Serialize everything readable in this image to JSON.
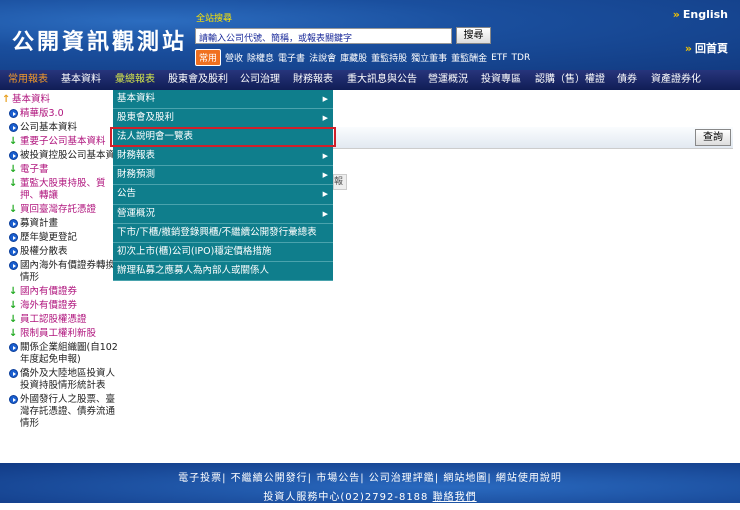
{
  "header": {
    "logo": "公開資訊觀測站",
    "search_label": "全站搜尋",
    "search_placeholder": "請輸入公司代號、簡稱，或報表關鍵字",
    "search_button": "搜尋",
    "quick_tag": "常用",
    "quick_links": [
      "營收",
      "除權息",
      "電子書",
      "法說會",
      "庫藏股",
      "董監持股",
      "獨立董事",
      "董監酬金",
      "ETF",
      "TDR"
    ],
    "english": "English",
    "home": "回首頁"
  },
  "nav": [
    "常用報表",
    "基本資料",
    "彙總報表",
    "股東會及股利",
    "公司治理",
    "財務報表",
    "重大訊息與公告",
    "營運概況",
    "投資專區",
    "認購（售）權證",
    "債券",
    "資產證券化"
  ],
  "sidebar": [
    {
      "t": "基本資料",
      "k": "top"
    },
    {
      "t": "精華版3.0",
      "k": "sub-ic"
    },
    {
      "t": "公司基本資料",
      "k": "ic"
    },
    {
      "t": "重要子公司基本資料",
      "k": "dl"
    },
    {
      "t": "被投資控股公司基本資",
      "k": "ic"
    },
    {
      "t": "電子書",
      "k": "dl"
    },
    {
      "t": "董監大股東持股、質押、轉讓",
      "k": "dl"
    },
    {
      "t": "買回臺灣存託憑證",
      "k": "dl"
    },
    {
      "t": "募資計畫",
      "k": "ic"
    },
    {
      "t": "歷年變更登記",
      "k": "ic"
    },
    {
      "t": "股權分散表",
      "k": "ic"
    },
    {
      "t": "國內海外有價證券轉換情形",
      "k": "ic"
    },
    {
      "t": "國內有價證券",
      "k": "dl"
    },
    {
      "t": "海外有價證券",
      "k": "dl"
    },
    {
      "t": "員工認股權憑證",
      "k": "dl"
    },
    {
      "t": "限制員工權利新股",
      "k": "dl"
    },
    {
      "t": "關係企業組織圖(自102年度起免申報)",
      "k": "ic"
    },
    {
      "t": "僑外及大陸地區投資人投資持股情形統計表",
      "k": "ic"
    },
    {
      "t": "外國發行人之股票、臺灣存託憑證、債券流通情形",
      "k": "ic"
    }
  ],
  "menu": [
    {
      "t": "基本資料",
      "sub": true
    },
    {
      "t": "股東會及股利",
      "sub": true
    },
    {
      "t": "法人說明會一覽表",
      "sub": false
    },
    {
      "t": "財務報表",
      "sub": true
    },
    {
      "t": "財務預測",
      "sub": true
    },
    {
      "t": "公告",
      "sub": true
    },
    {
      "t": "營運概況",
      "sub": true
    },
    {
      "t": "下市/下櫃/撤銷登錄興櫃/不繼續公開發行彙總表",
      "sub": false
    },
    {
      "t": "初次上市(櫃)公司(IPO)穩定價格措施",
      "sub": false
    },
    {
      "t": "辦理私募之應募人為內部人或關係人",
      "sub": false
    }
  ],
  "query_button": "查詢",
  "fragment": "報",
  "footer": {
    "links": [
      "電子投票",
      "不繼續公開發行",
      "市場公告",
      "公司治理評鑑",
      "網站地圖",
      "網站使用說明"
    ],
    "service": "投資人服務中心(02)2792-8188",
    "contact": "聯絡我們"
  }
}
